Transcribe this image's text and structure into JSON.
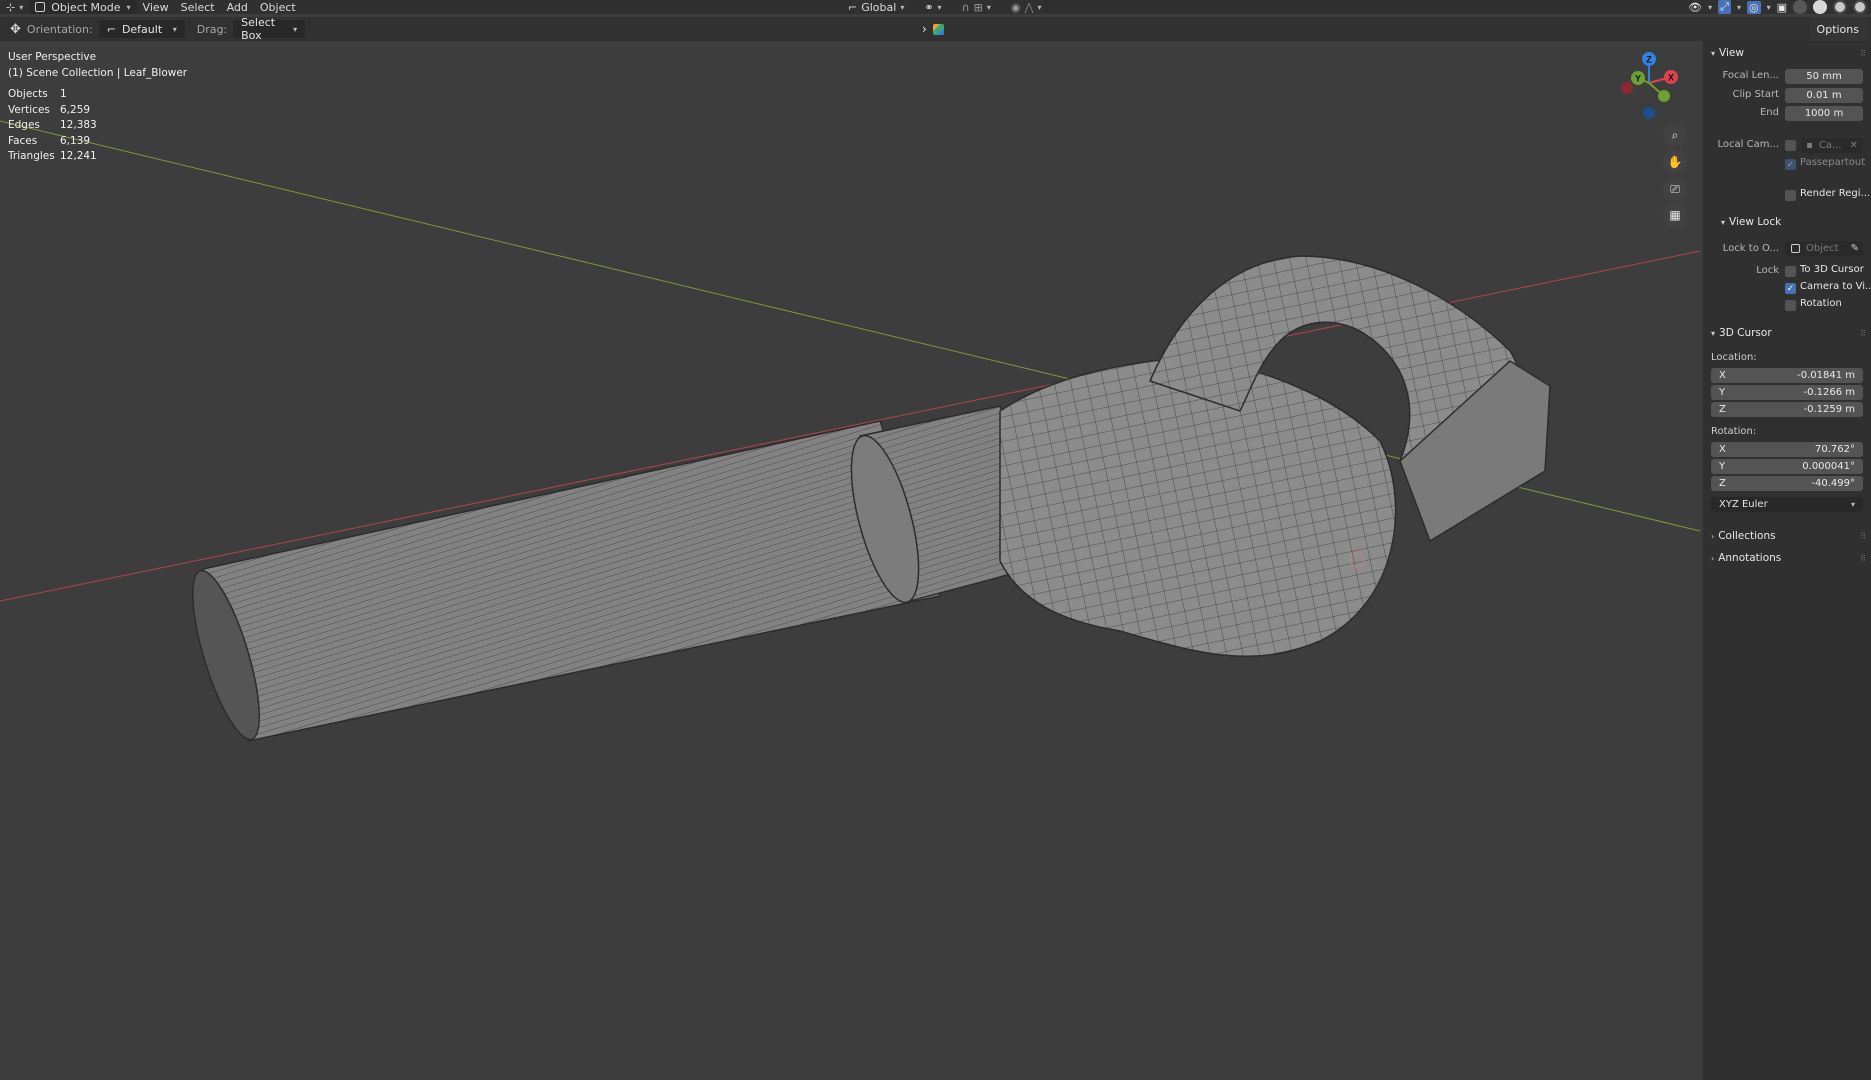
{
  "header": {
    "mode": "Object Mode",
    "menus": [
      "View",
      "Select",
      "Add",
      "Object"
    ],
    "transform_orientation": "Global"
  },
  "toolbar": {
    "orientation_label": "Orientation:",
    "orientation_value": "Default",
    "drag_label": "Drag:",
    "drag_value": "Select Box",
    "options_label": "Options"
  },
  "viewport": {
    "perspective": "User Perspective",
    "collection": "(1) Scene Collection | Leaf_Blower",
    "stats": [
      {
        "label": "Objects",
        "value": "1"
      },
      {
        "label": "Vertices",
        "value": "6,259"
      },
      {
        "label": "Edges",
        "value": "12,383"
      },
      {
        "label": "Faces",
        "value": "6,139"
      },
      {
        "label": "Triangles",
        "value": "12,241"
      }
    ],
    "gizmo": {
      "z": "Z",
      "y": "Y",
      "x": "X"
    }
  },
  "sidebar": {
    "view": {
      "title": "View",
      "focal_label": "Focal Len...",
      "focal_value": "50 mm",
      "clip_start_label": "Clip Start",
      "clip_start_value": "0.01 m",
      "clip_end_label": "End",
      "clip_end_value": "1000 m",
      "local_cam_label": "Local Cam...",
      "local_cam_value": "Ca...",
      "passepartout_label": "Passepartout",
      "render_region_label": "Render Regi..."
    },
    "view_lock": {
      "title": "View Lock",
      "lock_to_label": "Lock to O...",
      "lock_to_value": "Object",
      "lock_label": "Lock",
      "to_cursor_label": "To 3D Cursor",
      "camera_to_view_label": "Camera to Vi...",
      "rotation_label": "Rotation"
    },
    "cursor": {
      "title": "3D Cursor",
      "location_label": "Location:",
      "loc_x_label": "X",
      "loc_x": "-0.01841 m",
      "loc_y_label": "Y",
      "loc_y": "-0.1266 m",
      "loc_z_label": "Z",
      "loc_z": "-0.1259 m",
      "rotation_label": "Rotation:",
      "rot_x_label": "X",
      "rot_x": "70.762°",
      "rot_y_label": "Y",
      "rot_y": "0.000041°",
      "rot_z_label": "Z",
      "rot_z": "-40.499°",
      "rotation_mode": "XYZ Euler"
    },
    "collections_title": "Collections",
    "annotations_title": "Annotations"
  },
  "colors": {
    "viewport_bg": "#3d3d3d",
    "x_axis": "#b0454f",
    "y_axis": "#7d9a3a",
    "gizmo_x": "#e0424d",
    "gizmo_y": "#6ca133",
    "gizmo_z": "#2f82e0",
    "checkbox_on": "#4772b3"
  }
}
